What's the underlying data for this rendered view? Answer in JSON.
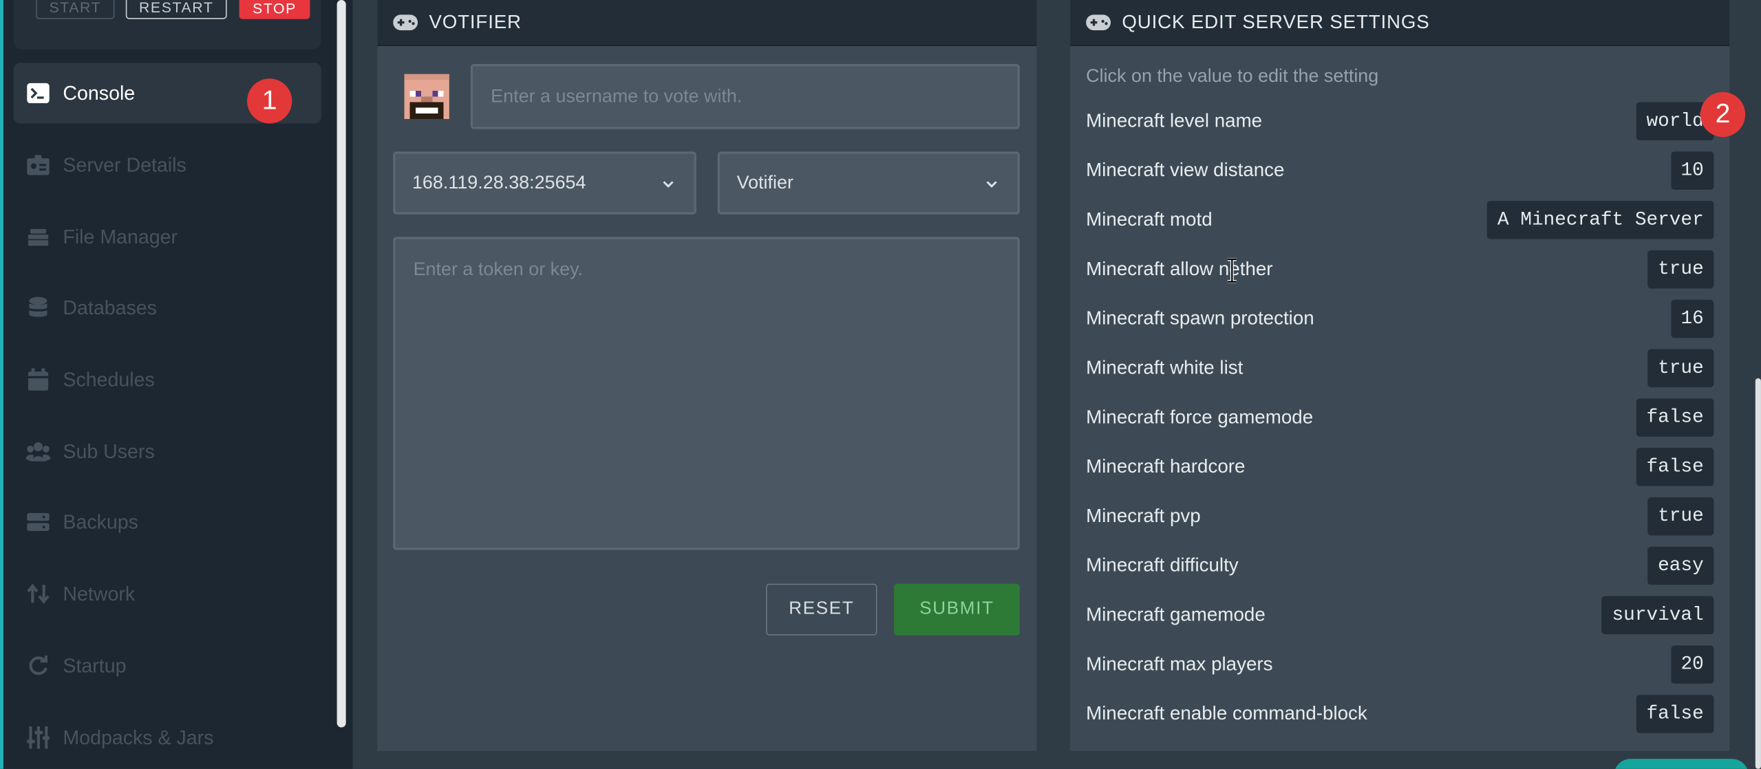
{
  "power": {
    "start": "START",
    "restart": "RESTART",
    "stop": "STOP"
  },
  "nav": [
    {
      "label": "Console",
      "icon": "terminal-icon",
      "active": true
    },
    {
      "label": "Server Details",
      "icon": "id-card-icon"
    },
    {
      "label": "File Manager",
      "icon": "layers-icon"
    },
    {
      "label": "Databases",
      "icon": "database-icon"
    },
    {
      "label": "Schedules",
      "icon": "calendar-icon"
    },
    {
      "label": "Sub Users",
      "icon": "users-icon"
    },
    {
      "label": "Backups",
      "icon": "server-icon"
    },
    {
      "label": "Network",
      "icon": "swap-arrows-icon"
    },
    {
      "label": "Startup",
      "icon": "refresh-icon"
    },
    {
      "label": "Modpacks & Jars",
      "icon": "sliders-icon"
    }
  ],
  "badges": {
    "one": "1",
    "two": "2"
  },
  "votifier": {
    "title": "VOTIFIER",
    "username_placeholder": "Enter a username to vote with.",
    "server_select": "168.119.28.38:25654",
    "plugin_select": "Votifier",
    "token_placeholder": "Enter a token or key.",
    "reset": "RESET",
    "submit": "SUBMIT"
  },
  "settings": {
    "title": "QUICK EDIT SERVER SETTINGS",
    "hint": "Click on the value to edit the setting",
    "rows": [
      {
        "label": "Minecraft level name",
        "value": "world"
      },
      {
        "label": "Minecraft view distance",
        "value": "10"
      },
      {
        "label": "Minecraft motd",
        "value": "A Minecraft Server"
      },
      {
        "label": "Minecraft allow nether",
        "value": "true"
      },
      {
        "label": "Minecraft spawn protection",
        "value": "16"
      },
      {
        "label": "Minecraft white list",
        "value": "true"
      },
      {
        "label": "Minecraft force gamemode",
        "value": "false"
      },
      {
        "label": "Minecraft hardcore",
        "value": "false"
      },
      {
        "label": "Minecraft pvp",
        "value": "true"
      },
      {
        "label": "Minecraft difficulty",
        "value": "easy"
      },
      {
        "label": "Minecraft gamemode",
        "value": "survival"
      },
      {
        "label": "Minecraft max players",
        "value": "20"
      },
      {
        "label": "Minecraft enable command-block",
        "value": "false"
      }
    ]
  },
  "colors": {
    "accent": "#22b3b8",
    "stop": "#e8363f",
    "submit": "#2d7a36",
    "badge": "#e33838"
  }
}
